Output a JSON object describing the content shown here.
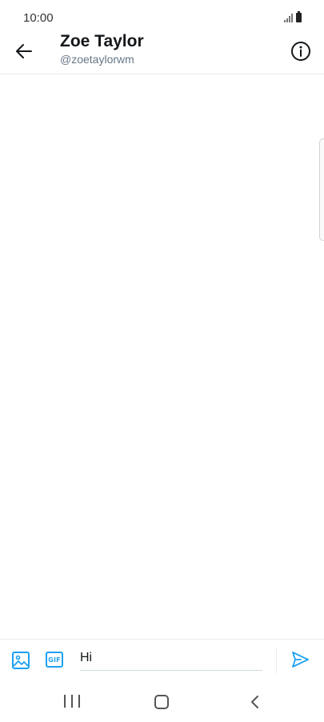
{
  "status_bar": {
    "time": "10:00"
  },
  "header": {
    "title": "Zoe Taylor",
    "handle": "@zoetaylorwm",
    "back_icon": "arrow-left-icon",
    "info_icon": "info-circle-icon"
  },
  "composer": {
    "message_value": "Hi",
    "image_icon": "image-icon",
    "gif_label": "GIF",
    "send_icon": "send-icon"
  },
  "colors": {
    "accent": "#1da1f2",
    "text_primary": "#14171a",
    "text_secondary": "#657786",
    "divider": "#e6ecf0"
  },
  "nav_bar": {
    "recents_icon": "recent-apps-icon",
    "home_icon": "home-icon",
    "back_icon": "nav-back-icon"
  }
}
